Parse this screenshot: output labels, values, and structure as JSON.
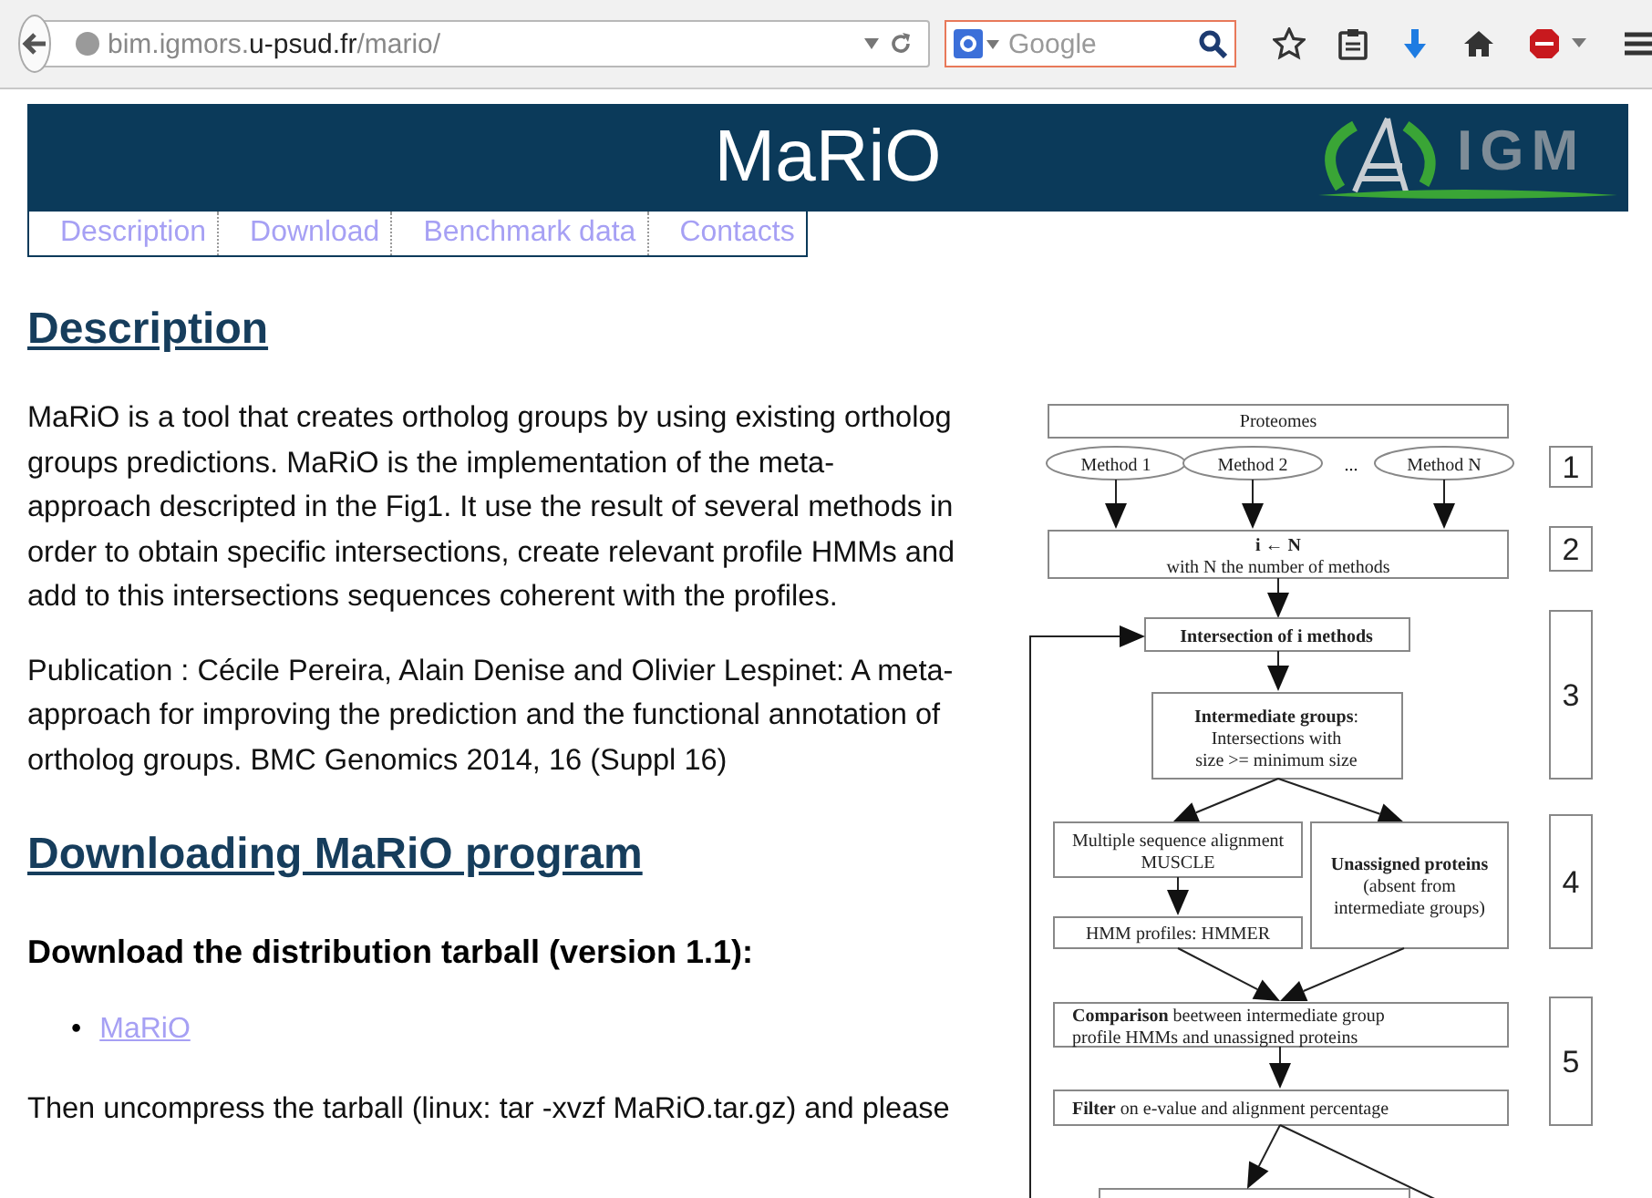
{
  "browser": {
    "url_parts": [
      {
        "text": "bim.igmors.",
        "strong": false
      },
      {
        "text": "u-psud.fr",
        "strong": true
      },
      {
        "text": "/mario/",
        "strong": false
      }
    ],
    "search": {
      "placeholder": "Google"
    }
  },
  "banner": {
    "title": "MaRiO",
    "logo_text": "IGM"
  },
  "nav": [
    {
      "label": "Description"
    },
    {
      "label": "Download"
    },
    {
      "label": "Benchmark data"
    },
    {
      "label": "Contacts"
    }
  ],
  "description": {
    "heading": "Description",
    "paragraphs": [
      "MaRiO is a tool that creates ortholog groups by using existing ortholog groups predictions. MaRiO is the implementation of the meta-approach descripted in the Fig1. It use the result of several methods in order to obtain specific intersections, create relevant profile HMMs and add to this intersections sequences coherent with the profiles.",
      "Publication : Cécile Pereira, Alain Denise and Olivier Lespinet: A meta-approach for improving the prediction and the functional annotation of ortholog groups. BMC Genomics 2014, 16 (Suppl 16)"
    ]
  },
  "download": {
    "heading": "Downloading MaRiO program",
    "subheading": "Download the distribution tarball (version 1.1):",
    "bullet": "•",
    "links": [
      "MaRiO"
    ],
    "note": "Then uncompress the tarball (linux: tar -xvzf MaRiO.tar.gz) and please"
  },
  "figure": {
    "proteomes": "Proteomes",
    "methods": [
      "Method 1",
      "Method 2",
      "...",
      "Method N"
    ],
    "init": {
      "bold": "i ← N",
      "rest": "with N the number of methods"
    },
    "intersection": "Intersection of i methods",
    "intermediate": {
      "bold": "Intermediate groups",
      "rest": ":",
      "lines": [
        "Intersections with",
        "size >= minimum size"
      ]
    },
    "alignment": [
      "Multiple sequence alignment",
      "MUSCLE"
    ],
    "unassigned": {
      "bold": "Unassigned proteins",
      "lines": [
        "(absent from",
        "intermediate groups)"
      ]
    },
    "hmm": "HMM profiles: HMMER",
    "comparison": {
      "bold": "Comparison",
      "rest": " beetween intermediate group",
      "line2": "profile HMMs and unassigned proteins"
    },
    "filter": {
      "bold": "Filter",
      "rest": " on e-value and alignment percentage"
    },
    "steps": [
      "1",
      "2",
      "3",
      "4",
      "5"
    ]
  }
}
